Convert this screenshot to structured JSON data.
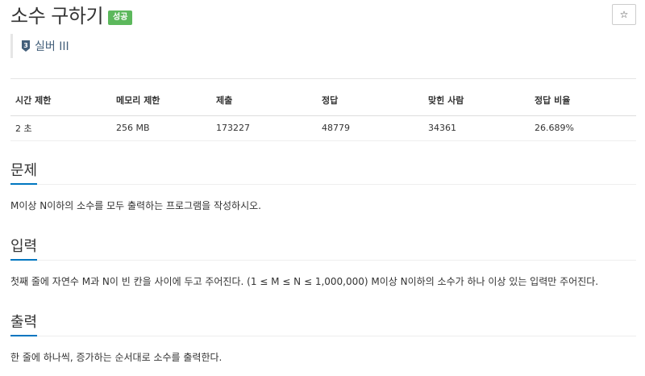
{
  "header": {
    "title": "소수 구하기",
    "badge": "성공",
    "star_icon": "☆"
  },
  "tier": {
    "icon_number": "3",
    "label": "실버 III",
    "color": "#435f7a"
  },
  "stats": {
    "headers": [
      "시간 제한",
      "메모리 제한",
      "제출",
      "정답",
      "맞힌 사람",
      "정답 비율"
    ],
    "values": [
      "2 초",
      "256 MB",
      "173227",
      "48779",
      "34361",
      "26.689%"
    ]
  },
  "sections": {
    "problem": {
      "title": "문제",
      "body": "M이상 N이하의 소수를 모두 출력하는 프로그램을 작성하시오."
    },
    "input": {
      "title": "입력",
      "body": "첫째 줄에 자연수 M과 N이 빈 칸을 사이에 두고 주어진다. (1 ≤ M ≤ N ≤ 1,000,000) M이상 N이하의 소수가 하나 이상 있는 입력만 주어진다."
    },
    "output": {
      "title": "출력",
      "body": "한 줄에 하나씩, 증가하는 순서대로 소수를 출력한다."
    }
  },
  "colors": {
    "accent": "#0076c0",
    "success": "#5cb85c"
  }
}
